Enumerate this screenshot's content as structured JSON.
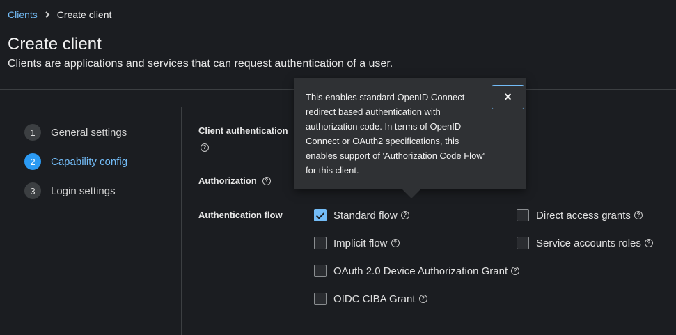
{
  "breadcrumb": {
    "parent": "Clients",
    "current": "Create client"
  },
  "header": {
    "title": "Create client",
    "description": "Clients are applications and services that can request authentication of a user."
  },
  "wizard": {
    "steps": [
      {
        "num": "1",
        "label": "General settings",
        "active": false
      },
      {
        "num": "2",
        "label": "Capability config",
        "active": true
      },
      {
        "num": "3",
        "label": "Login settings",
        "active": false
      }
    ]
  },
  "form": {
    "client_authentication_label": "Client authentication",
    "authorization_label": "Authorization",
    "authentication_flow_label": "Authentication flow",
    "flows": {
      "standard_flow": {
        "label": "Standard flow",
        "checked": true
      },
      "direct_access_grants": {
        "label": "Direct access grants",
        "checked": false
      },
      "implicit_flow": {
        "label": "Implicit flow",
        "checked": false
      },
      "service_accounts_roles": {
        "label": "Service accounts roles",
        "checked": false
      },
      "oauth_device_grant": {
        "label": "OAuth 2.0 Device Authorization Grant",
        "checked": false
      },
      "oidc_ciba_grant": {
        "label": "OIDC CIBA Grant",
        "checked": false
      }
    }
  },
  "popover": {
    "text": "This enables standard OpenID Connect redirect based authentication with authorization code. In terms of OpenID Connect or OAuth2 specifications, this enables support of 'Authorization Code Flow' for this client.",
    "close_icon": "×"
  },
  "colors": {
    "accent": "#73bcf7",
    "active_step": "#2b9af3",
    "background": "#1b1d21",
    "popover_bg": "#2f3134"
  }
}
